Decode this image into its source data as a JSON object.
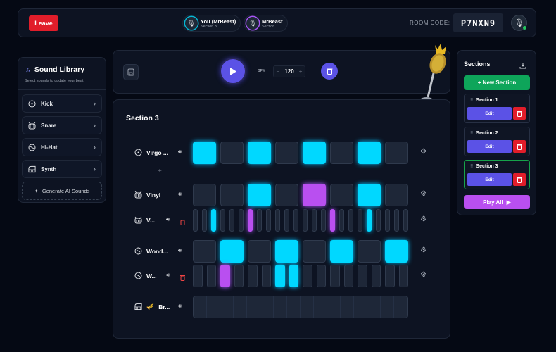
{
  "header": {
    "leave_label": "Leave",
    "users": [
      {
        "name": "You (MrBeast)",
        "section": "Section 3",
        "ring": "#06b6d4"
      },
      {
        "name": "MrBeast",
        "section": "Section 1",
        "ring": "#a855f7"
      }
    ],
    "room_code_label": "ROOM CODE:",
    "room_code": "P7NXN9"
  },
  "library": {
    "title": "Sound Library",
    "subtitle": "Select sounds to update your beat",
    "items": [
      {
        "label": "Kick",
        "icon": "kick-icon"
      },
      {
        "label": "Snare",
        "icon": "snare-icon"
      },
      {
        "label": "Hi-Hat",
        "icon": "hihat-icon"
      },
      {
        "label": "Synth",
        "icon": "piano-icon"
      }
    ],
    "generate_label": "Generate AI Sounds"
  },
  "toolbar": {
    "bpm_label": "BPM",
    "bpm": "120",
    "minus": "−",
    "plus": "+"
  },
  "main": {
    "section_title": "Section 3",
    "add_label": "+",
    "tracks": [
      {
        "name": "Virgo ...",
        "icon": "kick",
        "steps": 8,
        "on": [
          0,
          2,
          4,
          6
        ],
        "colors": [
          "c",
          "c",
          "c",
          "c"
        ],
        "removable": false
      },
      {
        "name": "Vinyl",
        "icon": "snare",
        "steps": 8,
        "on": [
          2,
          4,
          6
        ],
        "colors": [
          "c",
          "p",
          "c"
        ],
        "removable": false
      },
      {
        "name": "V...",
        "icon": "snare",
        "steps": 24,
        "on": [
          2,
          6,
          15,
          19
        ],
        "colors": [
          "c",
          "p",
          "p",
          "c"
        ],
        "removable": true
      },
      {
        "name": "Wond...",
        "icon": "hihat",
        "steps": 8,
        "on": [
          1,
          3,
          5,
          7
        ],
        "colors": [
          "c",
          "c",
          "c",
          "c"
        ],
        "removable": false
      },
      {
        "name": "W...",
        "icon": "hihat",
        "steps": 16,
        "on": [
          2,
          6,
          7
        ],
        "colors": [
          "p",
          "c",
          "c"
        ],
        "removable": true
      },
      {
        "name": "Br...",
        "icon": "piano",
        "steps": 0,
        "on": [],
        "colors": [],
        "removable": false,
        "emoji": "🎺"
      }
    ]
  },
  "sections": {
    "title": "Sections",
    "new_label": "+ New Section",
    "items": [
      {
        "name": "Section 1",
        "edit": "Edit",
        "active": false
      },
      {
        "name": "Section 2",
        "edit": "Edit",
        "active": false
      },
      {
        "name": "Section 3",
        "edit": "Edit",
        "active": true
      }
    ],
    "play_all_label": "Play All"
  },
  "colors": {
    "cyan": "#00d8ff",
    "purple": "#b94ff0",
    "accent": "#5b52e6",
    "danger": "#e11d2a",
    "success": "#0ea55a"
  }
}
